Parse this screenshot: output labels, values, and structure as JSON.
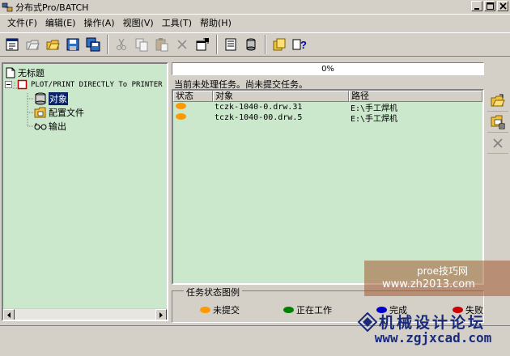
{
  "window": {
    "title": "分布式Pro/BATCH"
  },
  "menu": [
    {
      "label": "文件(F)"
    },
    {
      "label": "编辑(E)"
    },
    {
      "label": "操作(A)"
    },
    {
      "label": "视图(V)"
    },
    {
      "label": "工具(T)"
    },
    {
      "label": "帮助(H)"
    }
  ],
  "toolbar": {
    "buttons": [
      "new-db-icon",
      "open-icon",
      "open-folder-icon",
      "save-icon",
      "save-all-icon",
      "cut-icon",
      "copy-icon",
      "paste-icon",
      "delete-icon",
      "properties-icon",
      "script-icon",
      "start-icon",
      "about-icon",
      "help-icon"
    ]
  },
  "tree": {
    "root": "无标题",
    "task": "PLOT/PRINT DIRECTLY To PRINTER",
    "children": [
      "对象",
      "配置文件",
      "输出"
    ]
  },
  "progress": {
    "text": "0%",
    "value": 0
  },
  "status_message": "当前未处理任务。尚未提交任务。",
  "table": {
    "headers": {
      "status": "状态",
      "object": "对象",
      "path": "路径"
    },
    "rows": [
      {
        "status_color": "#ff9900",
        "object": "tczk-1040-0.drw.31",
        "path": "E:\\手工焊机"
      },
      {
        "status_color": "#ff9900",
        "object": "tczk-1040-00.drw.5",
        "path": "E:\\手工焊机"
      }
    ]
  },
  "legend": {
    "title": "任务状态图例",
    "items": [
      {
        "label": "未提交",
        "color": "#ff9900"
      },
      {
        "label": "正在工作",
        "color": "#008000"
      },
      {
        "label": "完成",
        "color": "#0000cc"
      },
      {
        "label": "失败",
        "color": "#cc0000"
      }
    ]
  },
  "watermark": {
    "site1_name": "proe技巧网",
    "site1_url": "www.zh2013.com",
    "site2_name": "机械设计论坛",
    "site2_url": "www.zgjxcad.com"
  }
}
